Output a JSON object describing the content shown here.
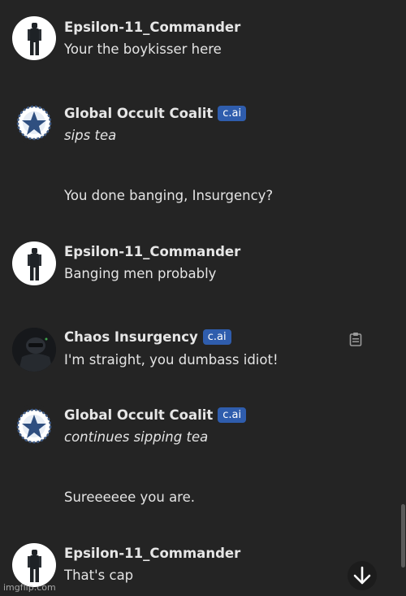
{
  "messages": [
    {
      "author": "Epsilon-11_Commander",
      "badge": "",
      "lines": [
        {
          "text": "Your the boykisser here",
          "italic": false
        }
      ]
    },
    {
      "author": "Global Occult Coalit",
      "badge": "c.ai",
      "lines": [
        {
          "text": "sips tea",
          "italic": true
        },
        {
          "text": "You done banging, Insurgency?",
          "italic": false
        }
      ]
    },
    {
      "author": "Epsilon-11_Commander",
      "badge": "",
      "lines": [
        {
          "text": "Banging men probably",
          "italic": false
        }
      ]
    },
    {
      "author": "Chaos Insurgency",
      "badge": "c.ai",
      "lines": [
        {
          "text": "I'm straight, you dumbass idiot!",
          "italic": false
        }
      ]
    },
    {
      "author": "Global Occult Coalit",
      "badge": "c.ai",
      "lines": [
        {
          "text": "continues sipping tea",
          "italic": true
        },
        {
          "text": "Sureeeeee you are.",
          "italic": false
        }
      ]
    },
    {
      "author": "Epsilon-11_Commander",
      "badge": "",
      "lines": [
        {
          "text": "That's cap",
          "italic": false
        }
      ]
    }
  ],
  "icons": {
    "avatar_epsilon": "soldier-figure-icon",
    "avatar_goc": "pentagram-emblem-icon",
    "avatar_chaos": "armored-soldier-icon",
    "copy": "clipboard-icon",
    "scroll_down": "arrow-down-icon"
  },
  "colors": {
    "background": "#242424",
    "badge": "#2f5dad",
    "text": "#e6e6e6"
  },
  "watermark": "imgflip.com"
}
